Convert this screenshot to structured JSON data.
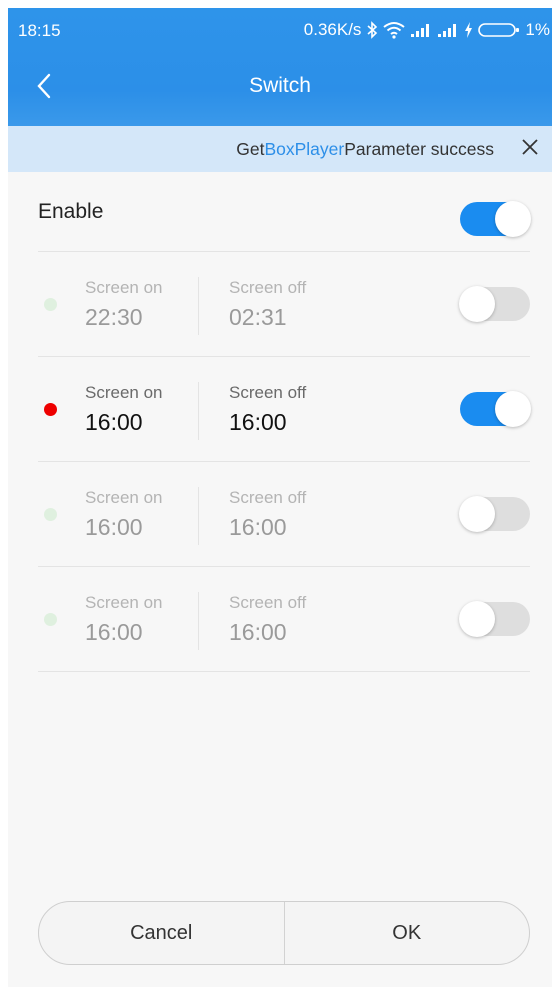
{
  "status_bar": {
    "time": "18:15",
    "net_speed": "0.36K/s",
    "battery": "1%"
  },
  "header": {
    "title": "Switch"
  },
  "toast": {
    "text_before": "Get",
    "text_highlight": "BoxPlayer",
    "text_after": "Parameter success"
  },
  "enable": {
    "label": "Enable",
    "on": true
  },
  "schedules": [
    {
      "on_label": "Screen on",
      "on_time": "22:30",
      "off_label": "Screen off",
      "off_time": "02:31",
      "enabled": false
    },
    {
      "on_label": "Screen on",
      "on_time": "16:00",
      "off_label": "Screen off",
      "off_time": "16:00",
      "enabled": true
    },
    {
      "on_label": "Screen on",
      "on_time": "16:00",
      "off_label": "Screen off",
      "off_time": "16:00",
      "enabled": false
    },
    {
      "on_label": "Screen on",
      "on_time": "16:00",
      "off_label": "Screen off",
      "off_time": "16:00",
      "enabled": false
    }
  ],
  "buttons": {
    "cancel": "Cancel",
    "ok": "OK"
  },
  "colors": {
    "accent": "#1a8cf0",
    "active_dot": "#ee0000",
    "inactive_dot": "#dff0df"
  },
  "icons": [
    "bluetooth-icon",
    "wifi-icon",
    "signal-icon",
    "charging-icon",
    "battery-icon",
    "back-arrow-icon",
    "close-icon"
  ]
}
